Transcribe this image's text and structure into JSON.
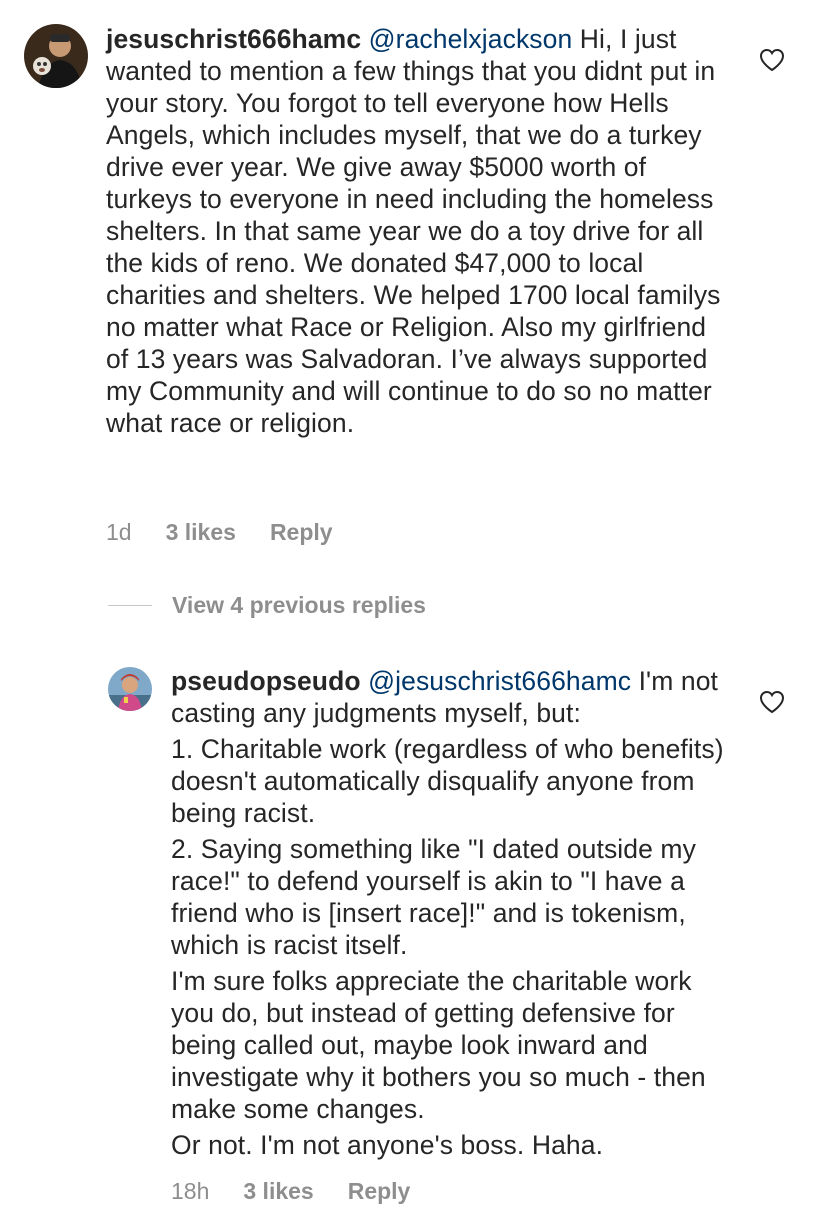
{
  "comments": [
    {
      "username": "jesuschrist666hamc",
      "mention": "@rachelxjackson",
      "text": "Hi, I just wanted to mention a few things that you didnt put in your story. You forgot to tell everyone how Hells Angels, which includes myself, that we do a turkey drive ever year. We give away $5000 worth of turkeys to everyone in need including the homeless shelters. In that same year we do a toy drive for all the kids of reno. We donated $47,000 to local charities and shelters. We helped 1700 local familys no matter what Race or Religion. Also my girlfriend of 13 years was Salvadoran. I’ve always supported my Community and will continue to do so no matter what race or religion.",
      "time": "1d",
      "likes": "3 likes",
      "reply_label": "Reply",
      "like_icon": "heart-outline-icon"
    },
    {
      "username": "pseudopseudo",
      "mention": "@jesuschrist666hamc",
      "first_line_text": "I'm not casting any judgments myself, but:",
      "paragraphs": [
        "1. Charitable work (regardless of who benefits) doesn't automatically disqualify anyone from being racist.",
        "2. Saying something like \"I dated outside my race!\" to defend yourself is akin to \"I have a friend who is [insert race]!\" and is tokenism, which is racist itself.",
        "I'm sure folks appreciate the charitable work you do, but instead of getting defensive for being called out, maybe look inward and investigate why it bothers you so much - then make some changes.",
        "Or not. I'm not anyone's boss. Haha."
      ],
      "time": "18h",
      "likes": "3 likes",
      "reply_label": "Reply",
      "like_icon": "heart-outline-icon"
    }
  ],
  "view_replies_label": "View 4 previous replies",
  "colors": {
    "text": "#262626",
    "mention": "#00376b",
    "secondary": "#8e8e8e",
    "divider": "#c7c7c7"
  }
}
